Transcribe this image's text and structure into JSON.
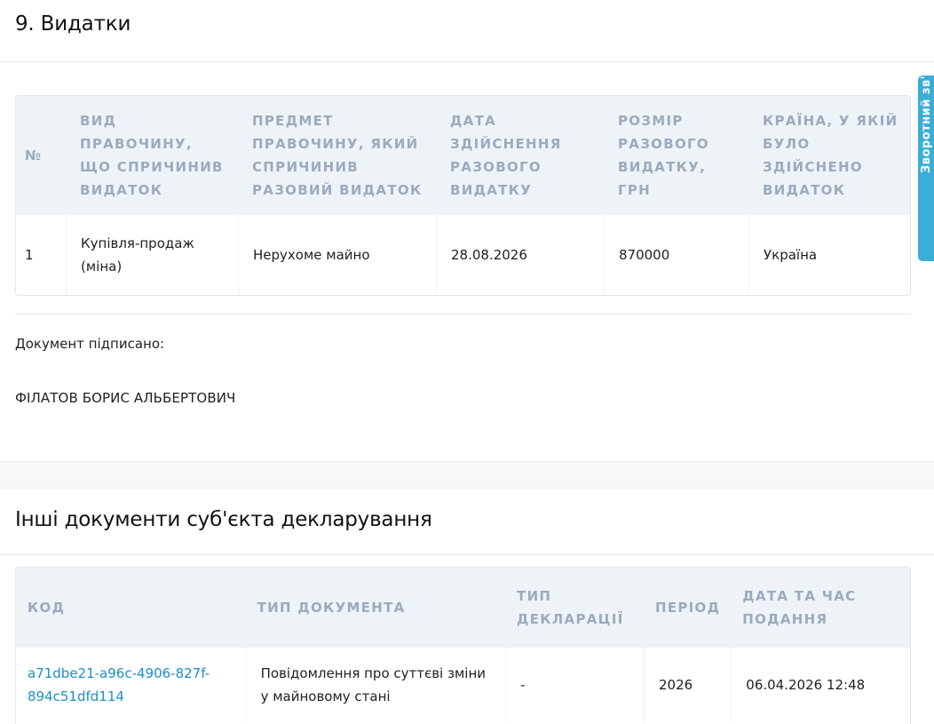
{
  "expenses": {
    "title": "9. Видатки",
    "columns": [
      "№",
      "Вид правочину, що спричинив видаток",
      "Предмет правочину, який спричинив разовий видаток",
      "Дата здійснення разового видатку",
      "Розмір разового видатку, грн",
      "Країна, у якій було здійснено видаток"
    ],
    "rows": [
      [
        "1",
        "Купівля-продаж (міна)",
        "Нерухоме майно",
        "28.08.2026",
        "870000",
        "Україна"
      ]
    ]
  },
  "signature": {
    "label": "Документ підписано:",
    "name": "ФІЛАТОВ БОРИС АЛЬБЕРТОВИЧ"
  },
  "other_docs": {
    "title": "Інші документи суб'єкта декларування",
    "columns": [
      "Код",
      "Тип документа",
      "Тип декларації",
      "Період",
      "Дата та час подання"
    ],
    "rows": [
      [
        "a71dbe21-a96c-4906-827f-894c51dfd114",
        "Повідомлення про суттєві зміни у майновому стані",
        "-",
        "2026",
        "06.04.2026 12:48"
      ]
    ]
  },
  "side_tab": {
    "label": "Зворотний зв'язок"
  },
  "colors": {
    "accent": "#3aaed8",
    "link": "#1b8fc4",
    "header_bg": "#eef3f8",
    "header_text": "#9aabbf"
  }
}
